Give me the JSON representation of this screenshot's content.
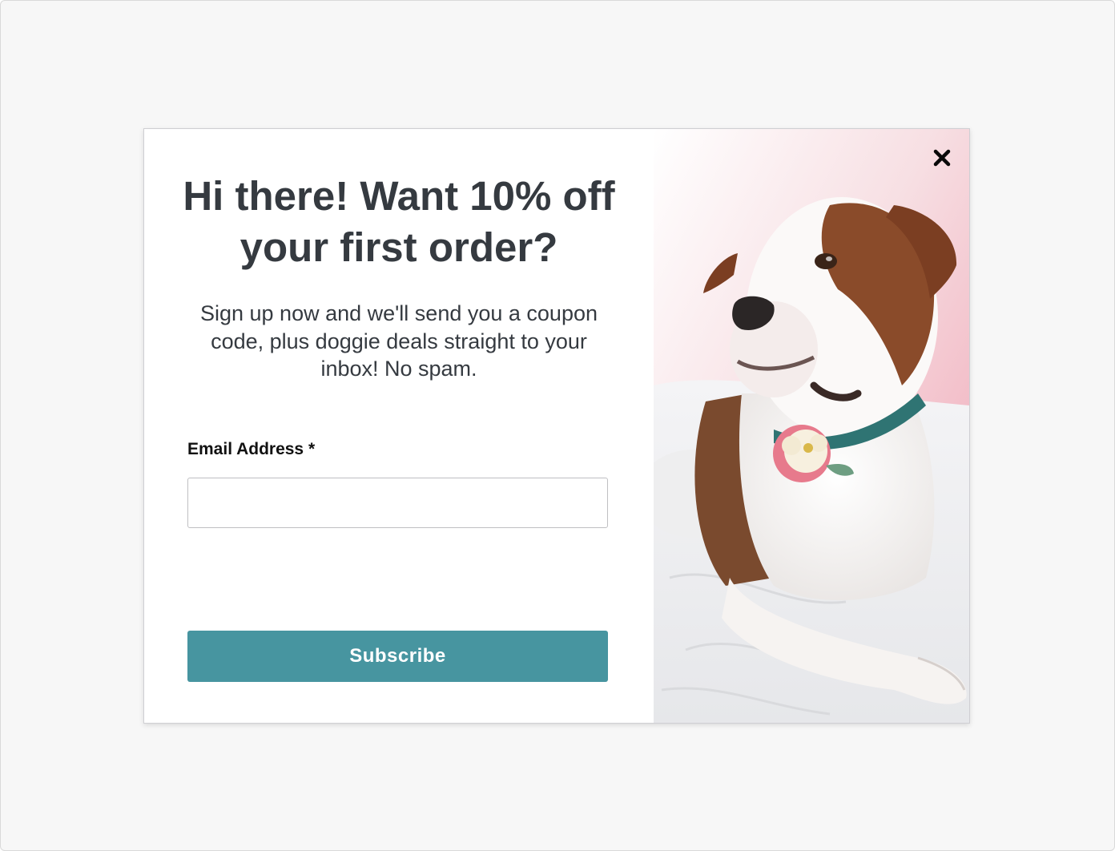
{
  "popup": {
    "headline": "Hi there! Want 10% off your first order?",
    "subtext": "Sign up now and we'll send you a coupon code, plus doggie deals straight to your inbox! No spam.",
    "email_label": "Email Address *",
    "email_value": "",
    "email_placeholder": "",
    "subscribe_label": "Subscribe",
    "close_icon": "close-icon",
    "image": "dog-photo"
  },
  "colors": {
    "button": "#4795a0",
    "text": "#353a40",
    "backdrop": "#f7f7f7"
  }
}
